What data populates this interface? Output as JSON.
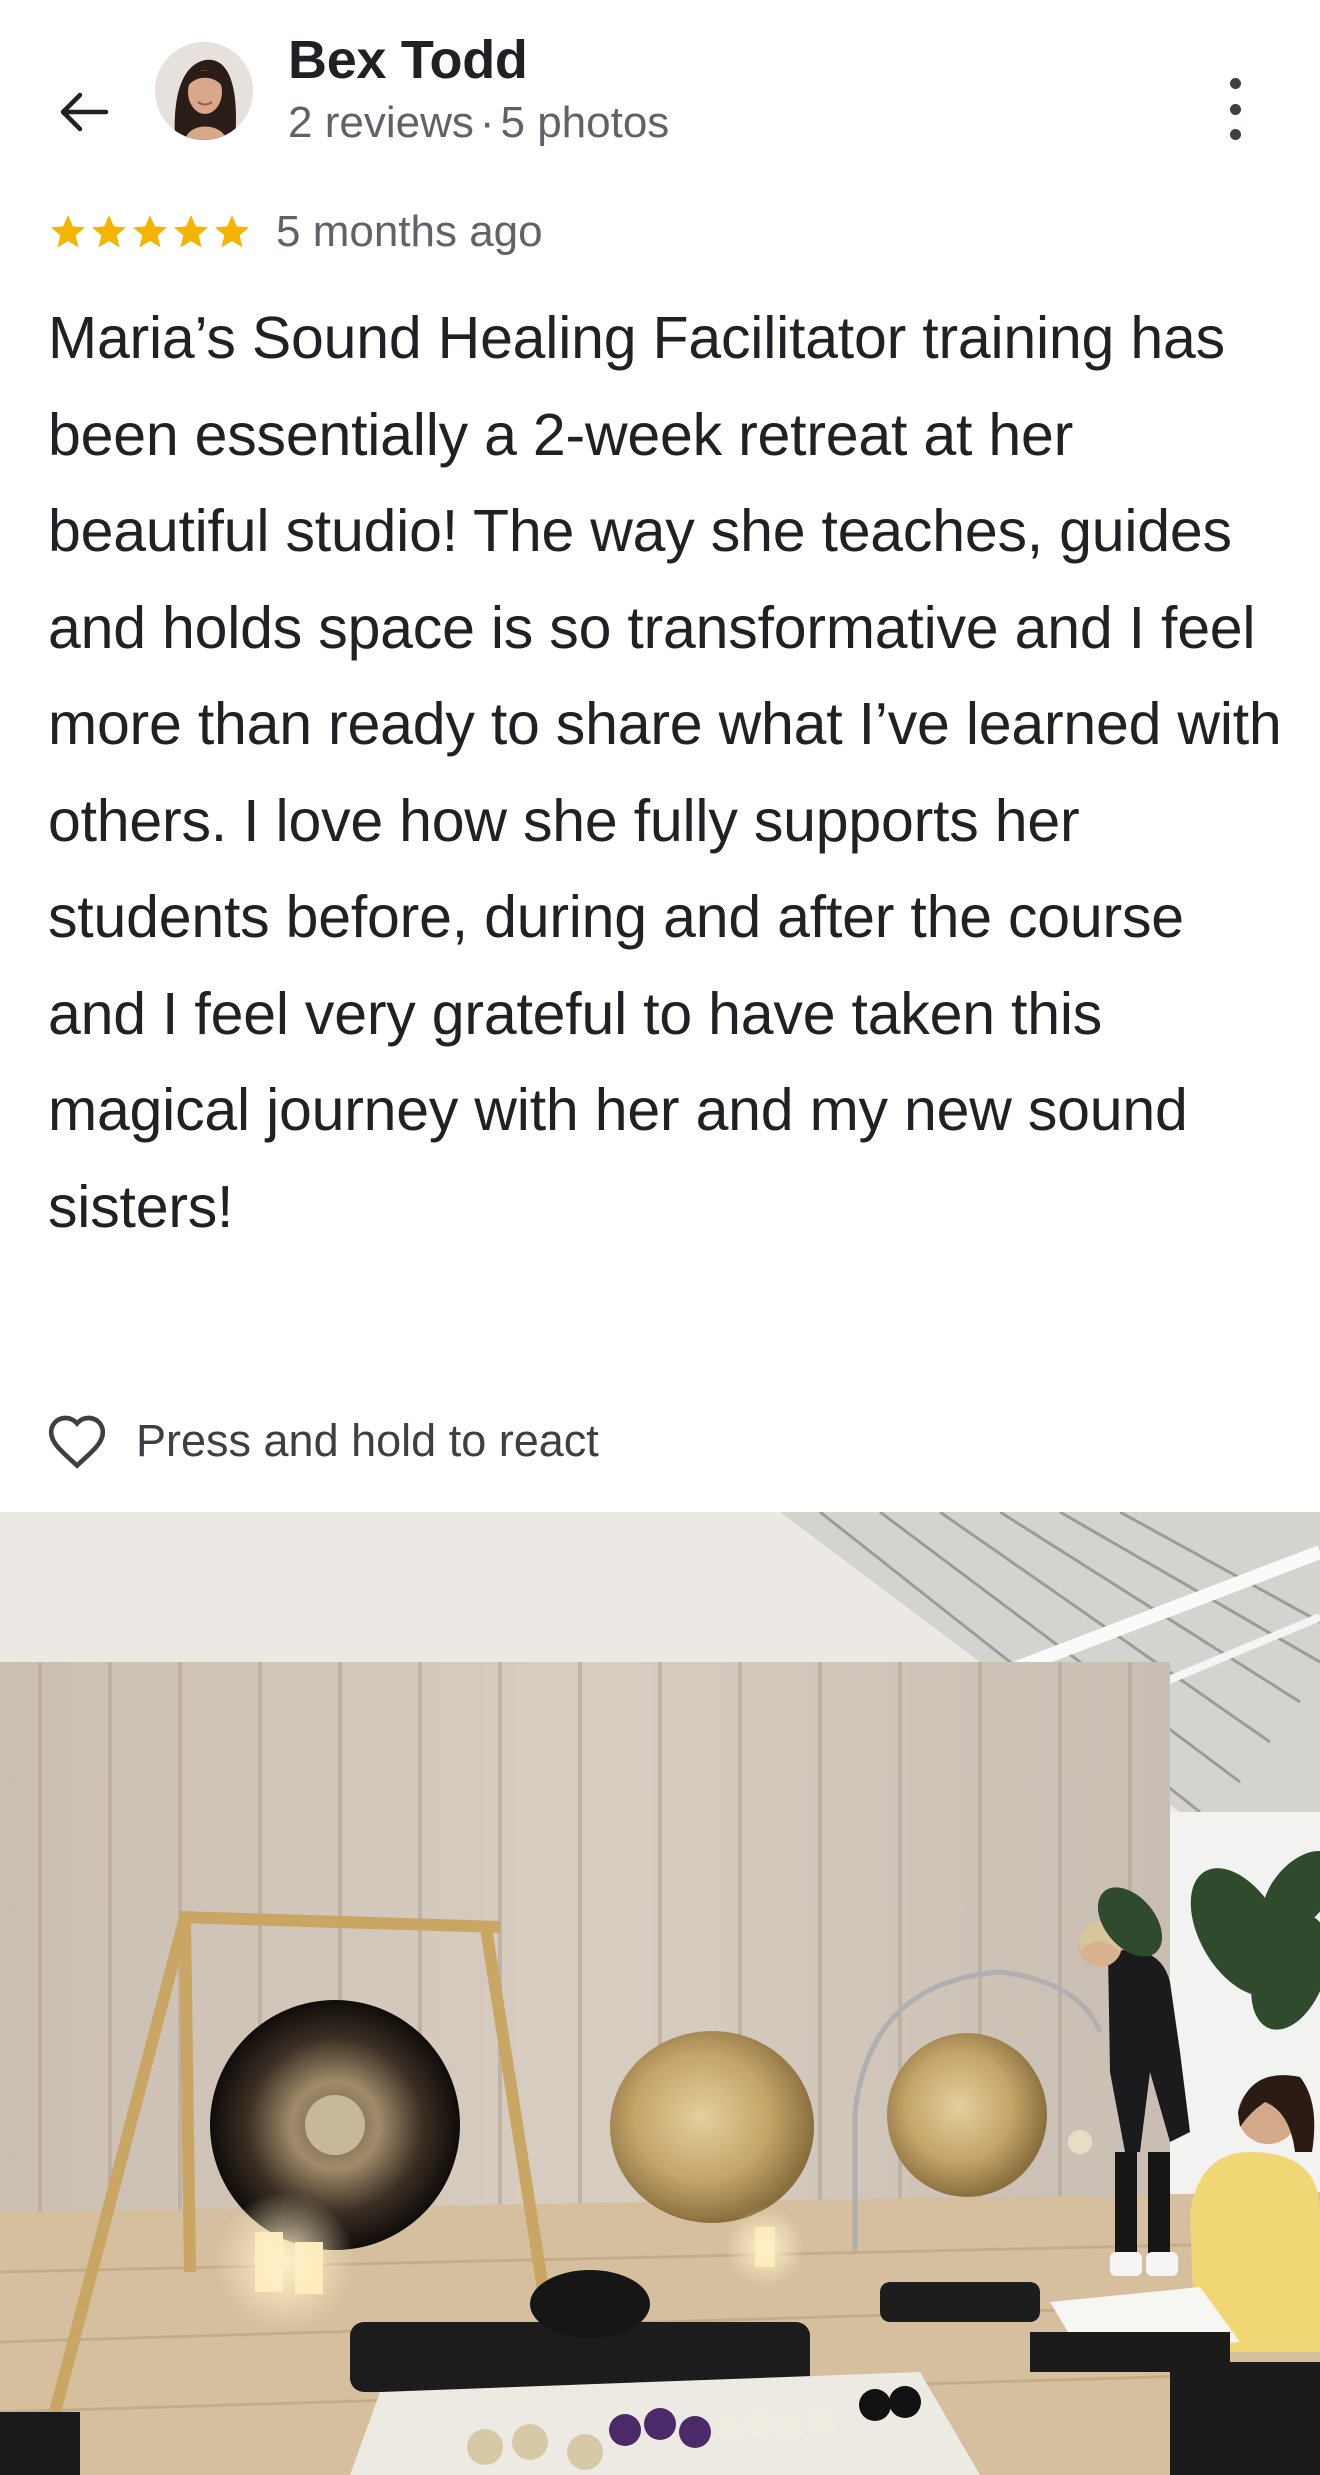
{
  "reviewer": {
    "name": "Bex Todd",
    "reviews_count": "2 reviews",
    "separator": "·",
    "photos_count": "5 photos"
  },
  "icons": {
    "back": "arrow-left-icon",
    "more": "more-vert-icon",
    "star": "star-icon",
    "react": "heart-outline-icon"
  },
  "review": {
    "rating": 5,
    "rating_max": 5,
    "age": "5 months ago",
    "text": "Maria’s Sound Healing Facilitator training has been essentially a 2-week retreat at her beautiful studio! The way she teaches, guides and holds space is so transformative and I feel more than ready to share what I’ve learned with others. I love how she fully supports her students before, during and after the course and I feel very grateful to have taken this magical journey with her and my new sound sisters!"
  },
  "react": {
    "label": "Press and hold to react"
  },
  "colors": {
    "star": "#f4b400",
    "text": "#202124",
    "secondary": "#5f6368"
  }
}
